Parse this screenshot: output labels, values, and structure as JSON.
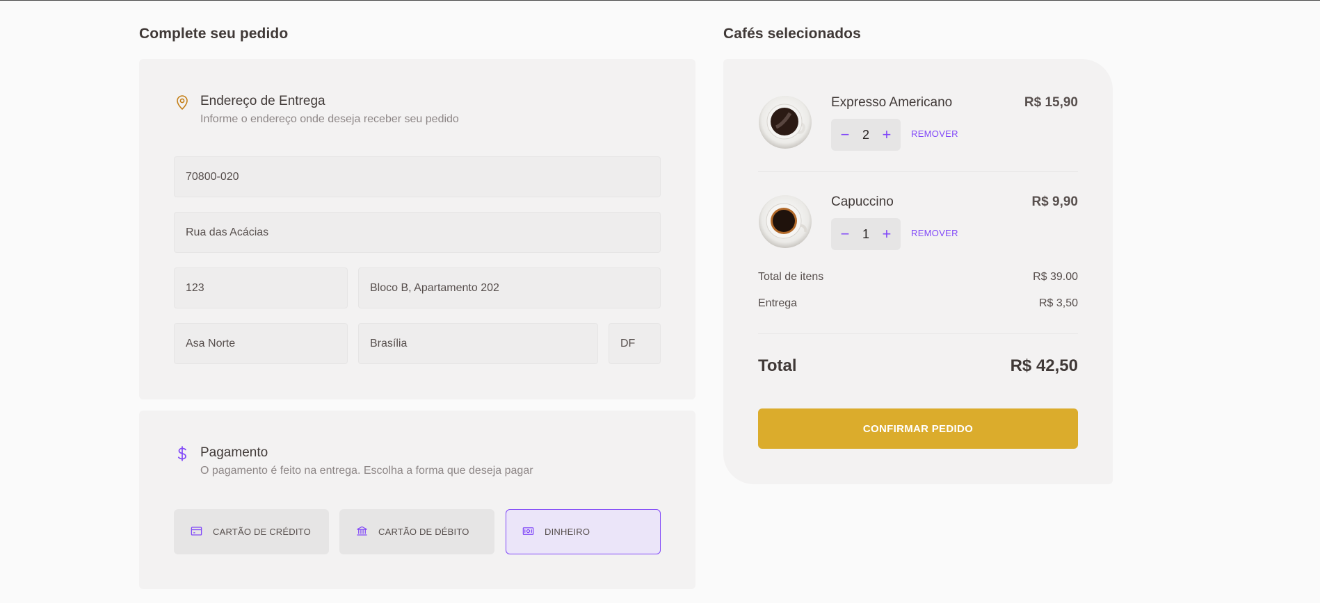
{
  "checkout": {
    "title": "Complete seu pedido",
    "address": {
      "title": "Endereço de Entrega",
      "subtitle": "Informe o endereço onde deseja receber seu pedido",
      "icon": "map-pin-icon",
      "fields": {
        "cep": "70800-020",
        "street": "Rua das Acácias",
        "number": "123",
        "complement": "Bloco B, Apartamento 202",
        "neighborhood": "Asa Norte",
        "city": "Brasília",
        "uf": "DF"
      }
    },
    "payment": {
      "title": "Pagamento",
      "subtitle": "O pagamento é feito na entrega. Escolha a forma que deseja pagar",
      "icon": "dollar-icon",
      "options": [
        {
          "label": "CARTÃO DE CRÉDITO",
          "icon": "credit-card-icon",
          "selected": false
        },
        {
          "label": "CARTÃO DE DÉBITO",
          "icon": "bank-icon",
          "selected": false
        },
        {
          "label": "DINHEIRO",
          "icon": "money-icon",
          "selected": true
        }
      ]
    }
  },
  "cart": {
    "title": "Cafés selecionados",
    "items": [
      {
        "name": "Expresso Americano",
        "price": "R$ 15,90",
        "qty": "2",
        "remove_label": "REMOVER"
      },
      {
        "name": "Capuccino",
        "price": "R$ 9,90",
        "qty": "1",
        "remove_label": "REMOVER"
      }
    ],
    "summary": {
      "items_label": "Total de itens",
      "items_value": "R$ 39.00",
      "delivery_label": "Entrega",
      "delivery_value": "R$ 3,50",
      "total_label": "Total",
      "total_value": "R$ 42,50"
    },
    "confirm_label": "CONFIRMAR PEDIDO"
  },
  "colors": {
    "purple": "#8047f8",
    "yellow": "#dbac2c",
    "yellow_dark": "#c47f17",
    "background": "#fafafa",
    "card": "#f3f2f2"
  }
}
